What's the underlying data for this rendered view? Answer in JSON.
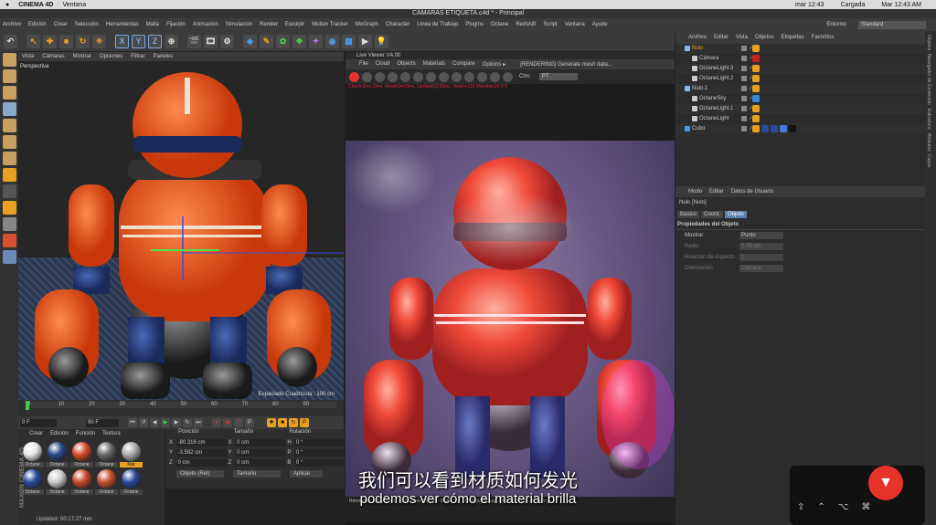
{
  "mac": {
    "app": "CINEMA 4D",
    "menu": "Ventana",
    "date1": "mar 12:43",
    "status": "Cargada",
    "date2": "Mar 12:43 AM"
  },
  "window_title": "CÁMARAS ETIQUETA.c4d * - Principal",
  "menubar": {
    "items": [
      "Archivo",
      "Edición",
      "Crear",
      "Selección",
      "Herramientas",
      "Malla",
      "Fijación",
      "Animación",
      "Simulación",
      "Render",
      "Esculpir",
      "Motion Tracker",
      "MoGraph",
      "Character",
      "Línea de Trabajo",
      "Plugins",
      "Octane",
      "Redshift",
      "Script",
      "Ventana",
      "Ayude"
    ],
    "env_label": "Entorno:",
    "env_value": "Standard"
  },
  "toolbar": {
    "axes": [
      "X",
      "Y",
      "Z"
    ]
  },
  "viewport": {
    "menu": [
      "Vista",
      "Cámaras",
      "Mostrar",
      "Opciones",
      "Filtrar",
      "Paneles"
    ],
    "label": "Perspectiva",
    "grid_spacing": "Espaciado Cuadrícula : 100 cm"
  },
  "timeline": {
    "ticks": [
      "0",
      "10",
      "20",
      "30",
      "40",
      "50",
      "60",
      "70",
      "80",
      "90"
    ],
    "start": "0 F",
    "end": "90 F"
  },
  "materials": {
    "menu": [
      "Crear",
      "Edición",
      "Función",
      "Textura"
    ],
    "items": [
      {
        "label": "Octane",
        "color": "#e8e8e8",
        "sel": false
      },
      {
        "label": "Octane",
        "color": "#2a4a8a",
        "sel": false
      },
      {
        "label": "Octane",
        "color": "#d84a2a",
        "sel": false
      },
      {
        "label": "Octane",
        "color": "#6a6a6a",
        "sel": false
      },
      {
        "label": "Mat",
        "color": "#aaaaaa",
        "sel": true
      },
      {
        "label": "Octane",
        "color": "#2a4a9a",
        "sel": false
      },
      {
        "label": "Octane",
        "color": "#cccccc",
        "sel": false
      },
      {
        "label": "Octane",
        "color": "#c84a2a",
        "sel": false
      },
      {
        "label": "Octane",
        "color": "#c85030",
        "sel": false
      },
      {
        "label": "Octane",
        "color": "#2a4a9a",
        "sel": false
      }
    ],
    "brand": "MAXON CINEMA 4D"
  },
  "coords": {
    "headers": [
      "Posición",
      "Tamaño",
      "Rotación"
    ],
    "rows": [
      {
        "axis": "X",
        "pos": "-80.316 cm",
        "size": "0 cm",
        "rlab": "H",
        "rot": "0 °"
      },
      {
        "axis": "Y",
        "pos": "-3.592 cm",
        "size": "0 cm",
        "rlab": "P",
        "rot": "0 °"
      },
      {
        "axis": "Z",
        "pos": "0 cm",
        "size": "0 cm",
        "rlab": "B",
        "rot": "0 °"
      }
    ],
    "mode": "Objeto (Rel)",
    "size_mode": "Tamaño",
    "apply": "Aplicar"
  },
  "status_text": "Updated: 00:17:27 min",
  "liveviewer": {
    "title": "Live Viewer V4.00",
    "menu": [
      "File",
      "Cloud",
      "Objects",
      "Materials",
      "Compare",
      "Options ▸"
    ],
    "rendering": "[RENDERING] Generate mesh data...",
    "chn_label": "Chn:",
    "chn_value": "PT",
    "stats": "Check:0ms./2ms. MeshGen:0ms. Update[G]:59ms. Nodes:118 Movable:28  0 0",
    "footer": "Rendering: 5%   Ms/sec: 1.224   Time: 00 : 00 : 00/00 : 07 : 09   Spp/maxspp: 64/2000   Mesh: 32   Hair: 0"
  },
  "objmgr": {
    "menu": [
      "Archivo",
      "Editar",
      "Vista",
      "Objetos",
      "Etiquetas",
      "Favoritos"
    ],
    "objects": [
      {
        "name": "Nulo",
        "indent": 0,
        "tags": [
          "#e8a020"
        ],
        "active": true
      },
      {
        "name": "Cámara",
        "indent": 1,
        "tags": [
          "#cc2020"
        ]
      },
      {
        "name": "OctaneLight.3",
        "indent": 1,
        "tags": [
          "#e8a020"
        ]
      },
      {
        "name": "OctaneLight.2",
        "indent": 1,
        "tags": [
          "#e8a020"
        ]
      },
      {
        "name": "Nulo.1",
        "indent": 0,
        "tags": [
          "#e8a020"
        ]
      },
      {
        "name": "OctaneSky",
        "indent": 1,
        "tags": [
          "#3a8ad8"
        ]
      },
      {
        "name": "OctaneLight.1",
        "indent": 1,
        "tags": [
          "#e8a020"
        ]
      },
      {
        "name": "OctaneLight",
        "indent": 1,
        "tags": [
          "#e8a020"
        ]
      },
      {
        "name": "Cubo",
        "indent": 0,
        "tags": [
          "#e8a020",
          "#2a4a9a",
          "#2a4a9a",
          "#4a7ad8",
          "#111111"
        ]
      }
    ]
  },
  "attr": {
    "menu": [
      "Modo",
      "Editar",
      "Datos de Usuario"
    ],
    "object": "Nulo [Nulo]",
    "tabs": [
      "Básico",
      "Coord.",
      "Objeto"
    ],
    "section": "Propiedades del Objeto",
    "props": [
      {
        "label": "Mostrar",
        "value": "Punto",
        "enabled": true
      },
      {
        "label": "Radio",
        "value": "2.05 cm",
        "enabled": false
      },
      {
        "label": "Relación de Aspecto",
        "value": "1",
        "enabled": false
      },
      {
        "label": "Orientación",
        "value": "Cámara",
        "enabled": false
      }
    ]
  },
  "sidetabs": [
    "Objetos",
    "Navegador de Contenido",
    "Estructura",
    "Atributos",
    "Capas"
  ],
  "subtitle_zh": "我们可以看到材质如何发光",
  "subtitle_es": "podemos ver cómo el material brilla"
}
